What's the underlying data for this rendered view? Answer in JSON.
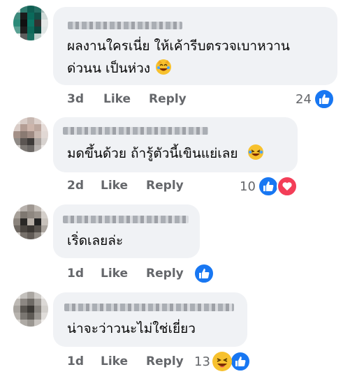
{
  "comments": [
    {
      "text_lines": [
        "ผลงานใครเนี่ย ให้เค้ารีบตรวจเบาหวาน",
        "ด่วนน เป็นห่วง"
      ],
      "emoji_icon": "grinning-cat-tears-icon",
      "time": "3d",
      "like_label": "Like",
      "reply_label": "Reply",
      "reaction_count": "24",
      "reactions": [
        "like-icon"
      ]
    },
    {
      "text_lines": [
        "มดขึ้นด้วย ถ้ารู้ตัวนี้เขินแย่เลย"
      ],
      "emoji_icon": "laughing-tears-icon",
      "time": "2d",
      "like_label": "Like",
      "reply_label": "Reply",
      "reaction_count": "10",
      "reactions": [
        "like-icon",
        "heart-icon"
      ]
    },
    {
      "text_lines": [
        "เริ่ดเลยล่ะ"
      ],
      "time": "1d",
      "like_label": "Like",
      "reply_label": "Reply",
      "reaction_count": "",
      "reactions": [
        "like-icon"
      ]
    },
    {
      "text_lines": [
        "น่าจะว่าวนะไม่ใช่เยี่ยว"
      ],
      "time": "1d",
      "like_label": "Like",
      "reply_label": "Reply",
      "reaction_count": "13",
      "reactions": [
        "haha-icon",
        "like-icon"
      ]
    }
  ],
  "colors": {
    "bubble": "#f0f2f5",
    "meta": "#65676b",
    "like_blue": "#1877f2",
    "heart_red": "#f33e58",
    "emoji_yellow": "#f7c12e"
  }
}
